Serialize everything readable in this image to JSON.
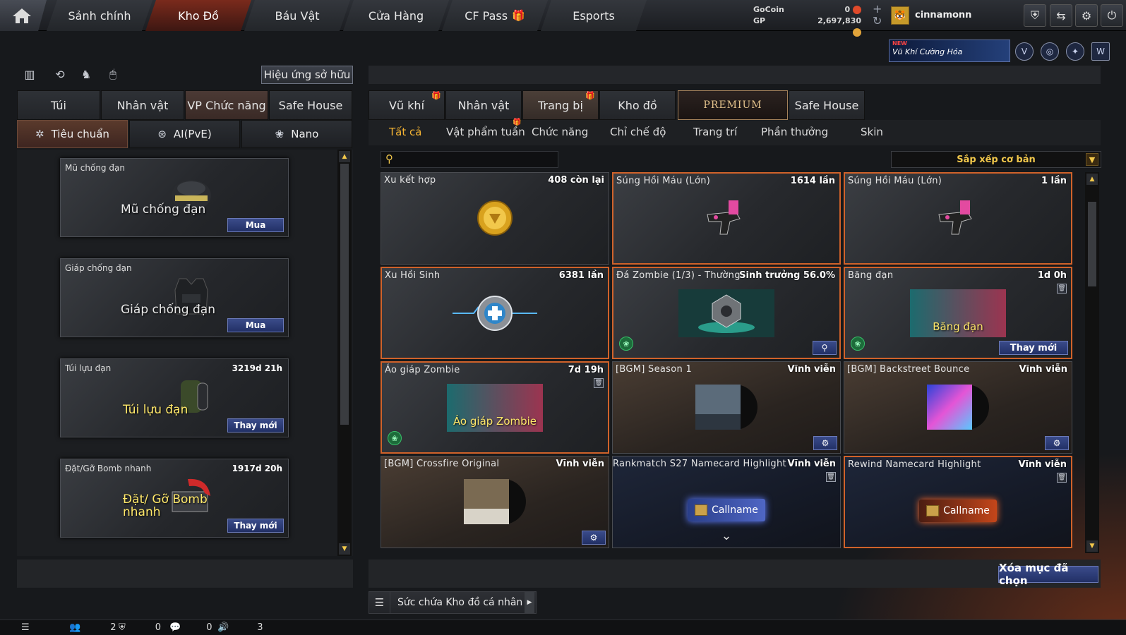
{
  "nav": {
    "tabs": [
      {
        "label": "Sảnh chính"
      },
      {
        "label": "Kho Đồ"
      },
      {
        "label": "Báu Vật"
      },
      {
        "label": "Cửa Hàng"
      },
      {
        "label": "CF Pass"
      },
      {
        "label": "Esports"
      }
    ],
    "active": "Kho Đồ",
    "gocoin_label": "GoCoin",
    "gocoin_value": "0",
    "gp_label": "GP",
    "gp_value": "2,697,830",
    "username": "cinnamonn",
    "icons": [
      "home-icon",
      "shield-icon",
      "exit-icon",
      "gear-icon",
      "power-icon"
    ]
  },
  "promo": {
    "badge": "NEW",
    "text": "Vũ Khí Cường Hóa"
  },
  "left": {
    "effect_button": "Hiệu ứng sở hữu",
    "tabs": [
      "Túi",
      "Nhân vật",
      "VP Chức năng",
      "Safe House"
    ],
    "active_tab": "VP Chức năng",
    "subtabs": [
      "Tiêu chuẩn",
      "AI(PvE)",
      "Nano"
    ],
    "active_subtab": "Tiêu chuẩn",
    "items": [
      {
        "title": "Mũ chống đạn",
        "duration": "",
        "caption": "Mũ chống đạn",
        "button": "Mua"
      },
      {
        "title": "Giáp chống đạn",
        "duration": "",
        "caption": "Giáp chống đạn",
        "button": "Mua"
      },
      {
        "title": "Túi lựu đạn",
        "duration": "3219d 21h",
        "caption": "Túi lựu đạn",
        "button": "Thay mới"
      },
      {
        "title": "Đặt/Gỡ Bomb nhanh",
        "duration": "1917d 20h",
        "caption": "Đặt/ Gỡ Bomb nhanh",
        "button": "Thay mới"
      }
    ]
  },
  "right": {
    "tabs": [
      {
        "label": "Vũ khí",
        "gift": true
      },
      {
        "label": "Nhân vật",
        "gift": false
      },
      {
        "label": "Trang bị",
        "gift": true
      },
      {
        "label": "Kho đồ",
        "gift": false
      },
      {
        "label": "PREMIUM",
        "gift": false
      },
      {
        "label": "Safe House",
        "gift": false
      }
    ],
    "active_tab": "Trang bị",
    "subtabs": [
      "Tất cả",
      "Vật phẩm tuần",
      "Chức năng",
      "Chỉ chế độ",
      "Trang trí",
      "Phần thưởng",
      "Skin"
    ],
    "active_subtab": "Tất cả",
    "search_placeholder": "",
    "sort_label": "Sắp xếp cơ bản",
    "items": [
      {
        "title": "Xu kết hợp",
        "duration": "408 còn lại",
        "selected": false,
        "style": "gray"
      },
      {
        "title": "Súng Hồi Máu (Lớn)",
        "duration": "1614 lần",
        "selected": true,
        "style": "gray"
      },
      {
        "title": "Súng Hồi Máu (Lớn)",
        "duration": "1 lần",
        "selected": true,
        "style": "gray"
      },
      {
        "title": "Xu Hồi Sinh",
        "duration": "6381 lần",
        "selected": true,
        "style": "gray"
      },
      {
        "title": "Đá Zombie (1/3) - Thường",
        "duration": "Sinh trưởng 56.0%",
        "selected": true,
        "style": "gray"
      },
      {
        "title": "Băng đạn",
        "duration": "1d 0h",
        "selected": true,
        "style": "gray",
        "caption": "Băng đạn",
        "button": "Thay mới"
      },
      {
        "title": "Áo giáp Zombie",
        "duration": "7d 19h",
        "selected": true,
        "style": "gray",
        "caption": "Áo giáp Zombie"
      },
      {
        "title": "[BGM] Season 1",
        "duration": "Vĩnh viễn",
        "selected": false,
        "style": "brown"
      },
      {
        "title": "[BGM] Backstreet Bounce",
        "duration": "Vĩnh viễn",
        "selected": false,
        "style": "brown"
      },
      {
        "title": "[BGM] Crossfire Original",
        "duration": "Vĩnh viễn",
        "selected": false,
        "style": "brown"
      },
      {
        "title": "Rankmatch S27 Namecard Highlight",
        "duration": "Vĩnh viễn",
        "selected": false,
        "style": "blue",
        "caption": "Callname"
      },
      {
        "title": "Rewind Namecard Highlight",
        "duration": "Vĩnh viễn",
        "selected": true,
        "style": "blue",
        "caption": "Callname"
      }
    ],
    "delete_button": "Xóa mục đã chọn",
    "capacity_label": "Sức chứa Kho đồ cá nhân"
  },
  "status": {
    "values": [
      "2",
      "0",
      "0",
      "3"
    ]
  },
  "colors": {
    "accent": "#f2b233",
    "selected_border": "#d0622a",
    "button_blue": "#223066"
  }
}
